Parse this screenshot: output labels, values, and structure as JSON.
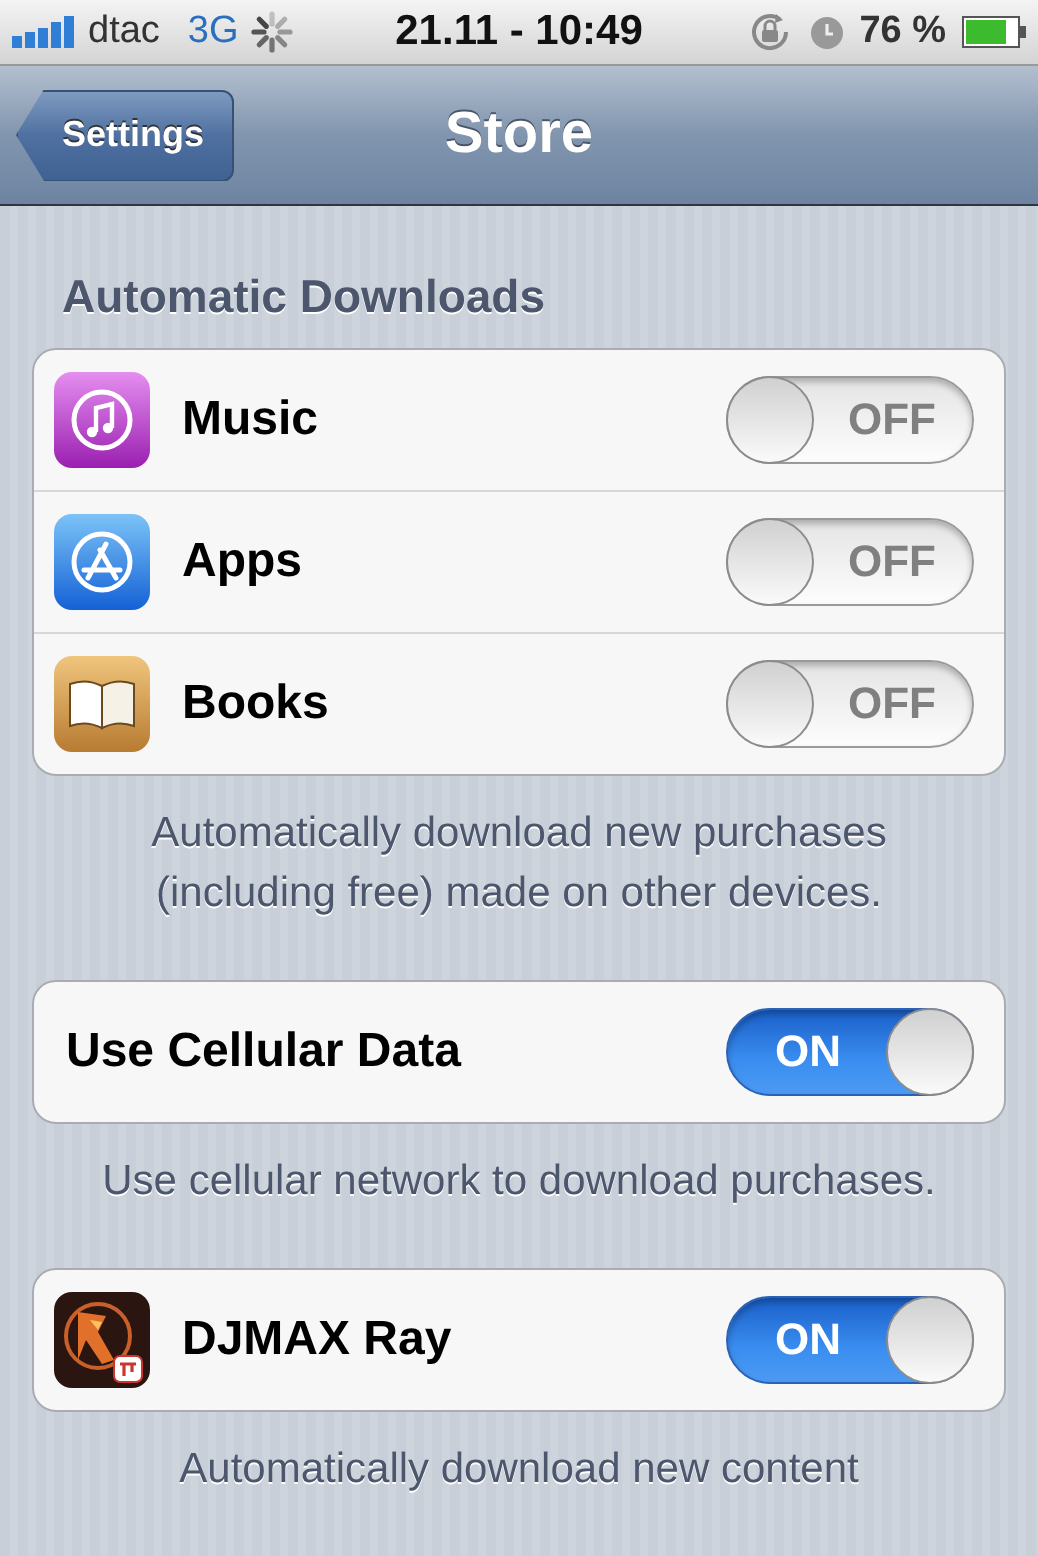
{
  "status_bar": {
    "carrier": "dtac",
    "network": "3G",
    "time": "21.11 - 10:49",
    "battery": "76 %"
  },
  "nav_bar": {
    "back": "Settings",
    "title": "Store"
  },
  "sections": [
    {
      "header": "Automatic Downloads",
      "rows": [
        {
          "kind": "music",
          "label": "Music",
          "on": false,
          "switch_text": "OFF"
        },
        {
          "kind": "apps",
          "label": "Apps",
          "on": false,
          "switch_text": "OFF"
        },
        {
          "kind": "books",
          "label": "Books",
          "on": false,
          "switch_text": "OFF"
        }
      ],
      "footer": "Automatically download new purchases (including free) made on other devices."
    },
    {
      "rows": [
        {
          "kind": "plain",
          "label": "Use Cellular Data",
          "on": true,
          "switch_text": "ON"
        }
      ],
      "footer": "Use cellular network to download purchases."
    },
    {
      "rows": [
        {
          "kind": "game",
          "label": "DJMAX Ray",
          "on": true,
          "switch_text": "ON"
        }
      ],
      "footer": "Automatically download new content"
    }
  ]
}
